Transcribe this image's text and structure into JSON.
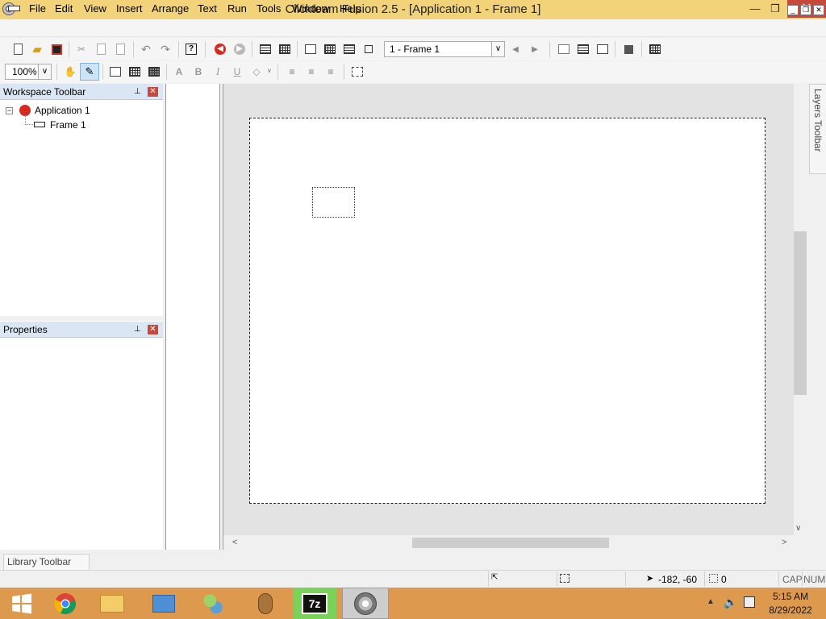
{
  "window": {
    "title": "Clickteam Fusion 2.5 - [Application 1 - Frame 1]",
    "minimize_glyph": "—",
    "restore_glyph": "❐",
    "close_glyph": "✕"
  },
  "menu": {
    "items": [
      "File",
      "Edit",
      "View",
      "Insert",
      "Arrange",
      "Text",
      "Run",
      "Tools",
      "Window",
      "Help"
    ],
    "mdi_minimize": "_",
    "mdi_restore": "❐",
    "mdi_close": "✕"
  },
  "toolbar": {
    "frame_select_value": "1 - Frame 1",
    "help_glyph": "?",
    "undo_glyph": "↶",
    "redo_glyph": "↷",
    "prev_glyph": "◀",
    "next_glyph": "▶",
    "cut_glyph": "✂",
    "hand_glyph": "✋",
    "bold_glyph": "B",
    "italic_glyph": "I",
    "underline_glyph": "U",
    "font_glyph": "A",
    "align_left_glyph": "≡",
    "align_center_glyph": "≡",
    "align_right_glyph": "≡",
    "zoom_value": "100%",
    "dropdown_glyph": "∨"
  },
  "workspace": {
    "title": "Workspace Toolbar",
    "tree": {
      "expander": "−",
      "application": "Application 1",
      "frame": "Frame 1"
    }
  },
  "properties": {
    "title": "Properties"
  },
  "layers": {
    "label": "Layers Toolbar"
  },
  "library": {
    "label": "Library Toolbar"
  },
  "status": {
    "coords": "-182, -60",
    "count": "0",
    "caps": "CAP",
    "num": "NUM"
  },
  "taskbar": {
    "time": "5:15 AM",
    "date": "8/29/2022",
    "sevenzip_label": "7z"
  },
  "colors": {
    "title_bar": "#f3d37a",
    "taskbar": "#dd9a4e",
    "close_red": "#c7493b",
    "panel_header": "#dbe6f4"
  }
}
